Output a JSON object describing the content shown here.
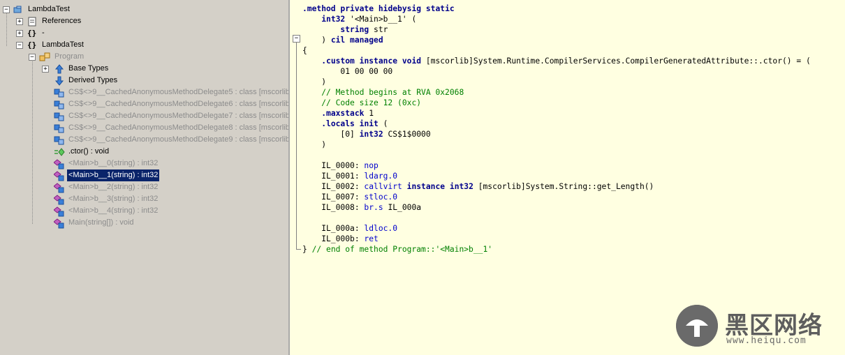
{
  "tree": {
    "root": "LambdaTest",
    "references": "References",
    "empty_namespace": "-",
    "namespace": "LambdaTest",
    "class": "Program",
    "base_types": "Base Types",
    "derived_types": "Derived Types",
    "fields": [
      "CS$<>9__CachedAnonymousMethodDelegate5 : class [mscorlib]",
      "CS$<>9__CachedAnonymousMethodDelegate6 : class [mscorlib]",
      "CS$<>9__CachedAnonymousMethodDelegate7 : class [mscorlib]",
      "CS$<>9__CachedAnonymousMethodDelegate8 : class [mscorlib]",
      "CS$<>9__CachedAnonymousMethodDelegate9 : class [mscorlib]"
    ],
    "ctor": ".ctor() : void",
    "methods": [
      "<Main>b__0(string) : int32",
      "<Main>b__1(string) : int32",
      "<Main>b__2(string) : int32",
      "<Main>b__3(string) : int32",
      "<Main>b__4(string) : int32",
      "Main(string[]) : void"
    ],
    "selected_method": "<Main>b__1(string) : int32"
  },
  "code": {
    "lines": [
      ".method private hidebysig static",
      "    int32 '<Main>b__1' (",
      "        string str",
      "    ) cil managed",
      "{",
      "    .custom instance void [mscorlib]System.Runtime.CompilerServices.CompilerGeneratedAttribute::.ctor() = (",
      "        01 00 00 00",
      "    )",
      "    // Method begins at RVA 0x2068",
      "    // Code size 12 (0xc)",
      "    .maxstack 1",
      "    .locals init (",
      "        [0] int32 CS$1$0000",
      "    )",
      "",
      "    IL_0000: nop",
      "    IL_0001: ldarg.0",
      "    IL_0002: callvirt instance int32 [mscorlib]System.String::get_Length()",
      "    IL_0007: stloc.0",
      "    IL_0008: br.s IL_000a",
      "",
      "    IL_000a: ldloc.0",
      "    IL_000b: ret",
      "} // end of method Program::'<Main>b__1'"
    ]
  },
  "watermark": {
    "title": "黑区网络",
    "url": "www.heiqu.com"
  },
  "colors": {
    "tree_bg": "#d4d0c8",
    "code_bg": "#ffffe1",
    "selection": "#0a246a",
    "keyword": "#00008b",
    "comment": "#008000"
  }
}
